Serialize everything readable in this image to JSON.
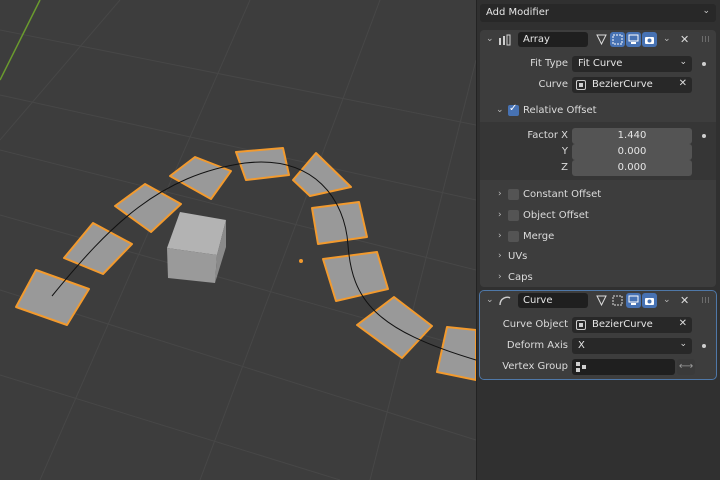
{
  "colors": {
    "viewport_bg": "#3d3d3d",
    "panel_bg": "#303030",
    "selection": "#f29a2e",
    "accent": "#4772b3"
  },
  "add_modifier": {
    "label": "Add Modifier"
  },
  "array_modifier": {
    "name": "Array",
    "fit_type_label": "Fit Type",
    "fit_type_value": "Fit Curve",
    "curve_label": "Curve",
    "curve_value": "BezierCurve",
    "relative_offset_label": "Relative Offset",
    "relative_offset_checked": true,
    "factor_x_label": "Factor X",
    "factor_x_value": "1.440",
    "factor_y_label": "Y",
    "factor_y_value": "0.000",
    "factor_z_label": "Z",
    "factor_z_value": "0.000",
    "sections": [
      {
        "label": "Constant Offset",
        "has_checkbox": true
      },
      {
        "label": "Object Offset",
        "has_checkbox": true
      },
      {
        "label": "Merge",
        "has_checkbox": true
      },
      {
        "label": "UVs",
        "has_checkbox": false
      },
      {
        "label": "Caps",
        "has_checkbox": false
      }
    ]
  },
  "curve_modifier": {
    "name": "Curve",
    "curve_object_label": "Curve Object",
    "curve_object_value": "BezierCurve",
    "deform_axis_label": "Deform Axis",
    "deform_axis_value": "X",
    "vertex_group_label": "Vertex Group",
    "vertex_group_value": ""
  }
}
